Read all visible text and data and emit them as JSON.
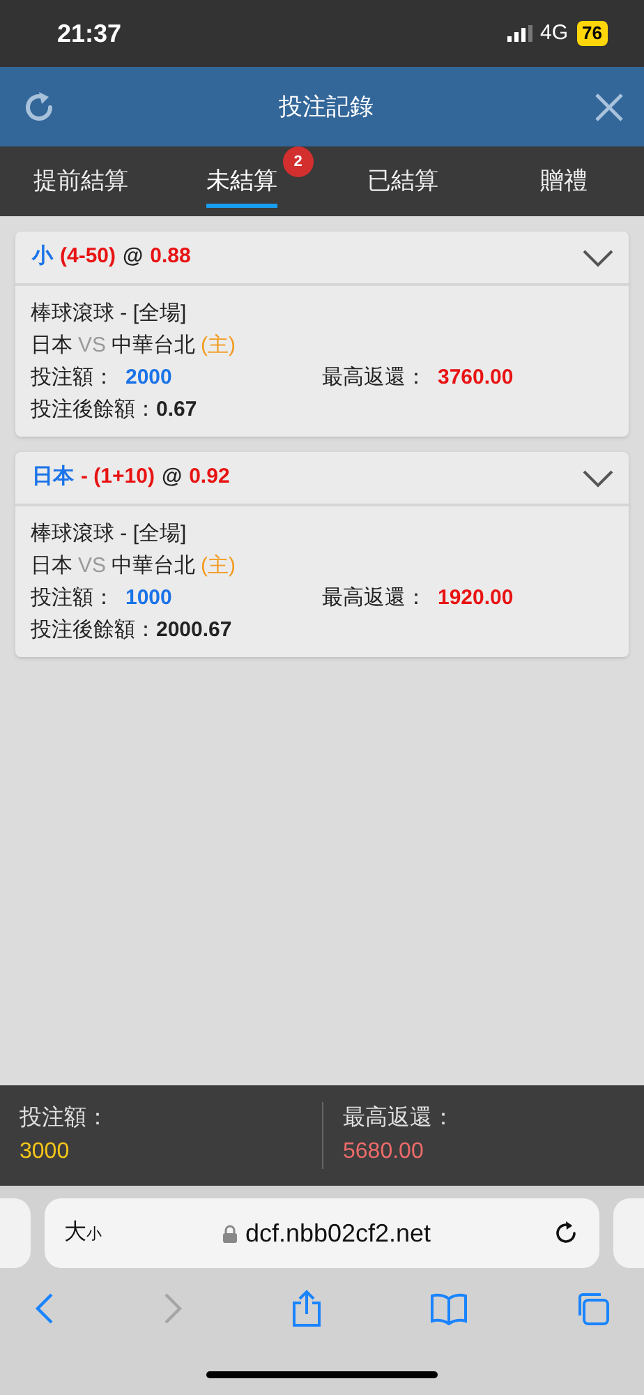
{
  "status_bar": {
    "time": "21:37",
    "network": "4G",
    "battery": "76"
  },
  "header": {
    "title": "投注記錄"
  },
  "tabs": [
    {
      "label": "提前結算",
      "selected": false
    },
    {
      "label": "未結算",
      "selected": true,
      "badge": "2"
    },
    {
      "label": "已結算",
      "selected": false
    },
    {
      "label": "贈禮",
      "selected": false
    }
  ],
  "bets": [
    {
      "selection": "小",
      "line": "(4-50)",
      "at": "@",
      "odds": "0.88",
      "expanded": true,
      "market": "棒球滾球 - [全場]",
      "home_team": "日本",
      "vs": "VS",
      "away_team": "中華台北",
      "home_mark": "(主)",
      "stake_label": "投注額：",
      "stake": "2000",
      "max_return_label": "最高返還：",
      "max_return": "3760.00",
      "balance_label": "投注後餘額：",
      "balance": "0.67"
    },
    {
      "selection": "日本",
      "line": "- (1+10)",
      "at": "@",
      "odds": "0.92",
      "expanded": true,
      "market": "棒球滾球 - [全場]",
      "home_team": "日本",
      "vs": "VS",
      "away_team": "中華台北",
      "home_mark": "(主)",
      "stake_label": "投注額：",
      "stake": "1000",
      "max_return_label": "最高返還：",
      "max_return": "1920.00",
      "balance_label": "投注後餘額：",
      "balance": "2000.67"
    }
  ],
  "summary": {
    "stake_label": "投注額：",
    "stake": "3000",
    "max_return_label": "最高返還：",
    "max_return": "5680.00"
  },
  "browser": {
    "text_size_large": "大",
    "text_size_small": "小",
    "url": "dcf.nbb02cf2.net"
  }
}
